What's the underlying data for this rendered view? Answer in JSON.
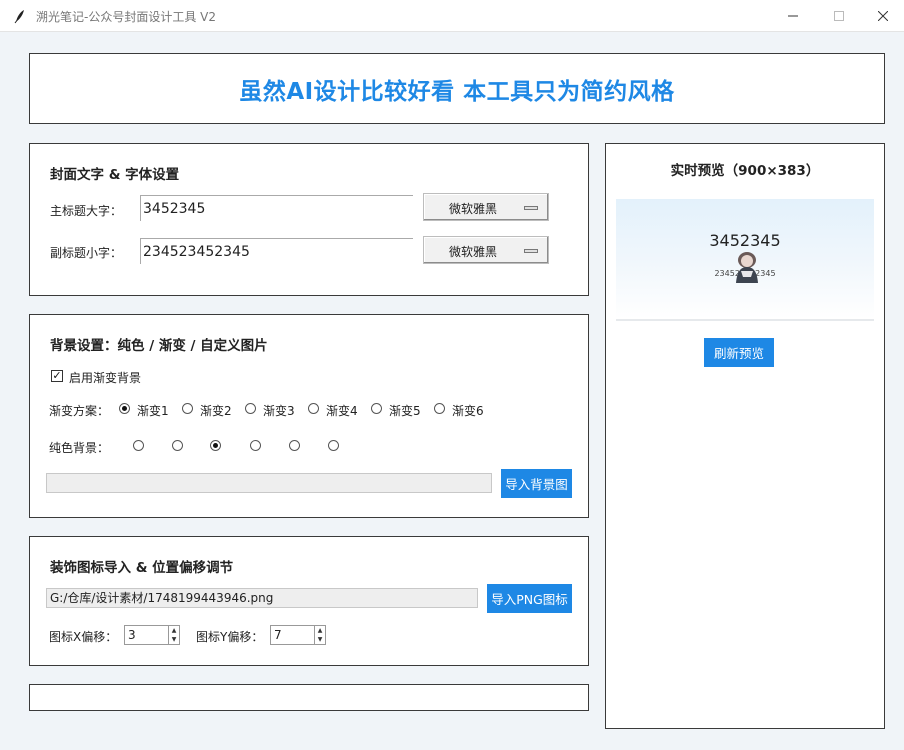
{
  "window": {
    "title": "溯光笔记-公众号封面设计工具 V2",
    "icons": {
      "app": "feather-icon",
      "minimize": "minimize-icon",
      "maximize": "maximize-icon",
      "close": "close-icon"
    }
  },
  "banner": {
    "text": "虽然AI设计比较好看 本工具只为简约风格",
    "color": "#1e88e5"
  },
  "text_settings": {
    "title": "封面文字 & 字体设置",
    "main_label": "主标题大字：",
    "main_value": "3452345",
    "main_font": "微软雅黑",
    "sub_label": "副标题小字：",
    "sub_value": "234523452345",
    "sub_font": "微软雅黑"
  },
  "background": {
    "title": "背景设置：纯色 / 渐变 / 自定义图片",
    "enable_gradient_label": "启用渐变背景",
    "enable_gradient_checked": true,
    "gradient_label": "渐变方案：",
    "gradients": [
      "渐变1",
      "渐变2",
      "渐变3",
      "渐变4",
      "渐变5",
      "渐变6"
    ],
    "gradient_selected": 0,
    "solid_label": "纯色背景：",
    "solid_selected": 2,
    "image_path": "",
    "import_button": "导入背景图"
  },
  "icon_settings": {
    "title": "装饰图标导入 & 位置偏移调节",
    "path": "G:/仓库/设计素材/1748199443946.png",
    "import_button": "导入PNG图标",
    "x_label": "图标X偏移：",
    "x_value": "3",
    "y_label": "图标Y偏移：",
    "y_value": "7"
  },
  "preview": {
    "title": "实时预览（900×383）",
    "main_text": "3452345",
    "sub_text": "234523452345",
    "refresh_button": "刷新预览",
    "accent": "#1e88e5"
  }
}
